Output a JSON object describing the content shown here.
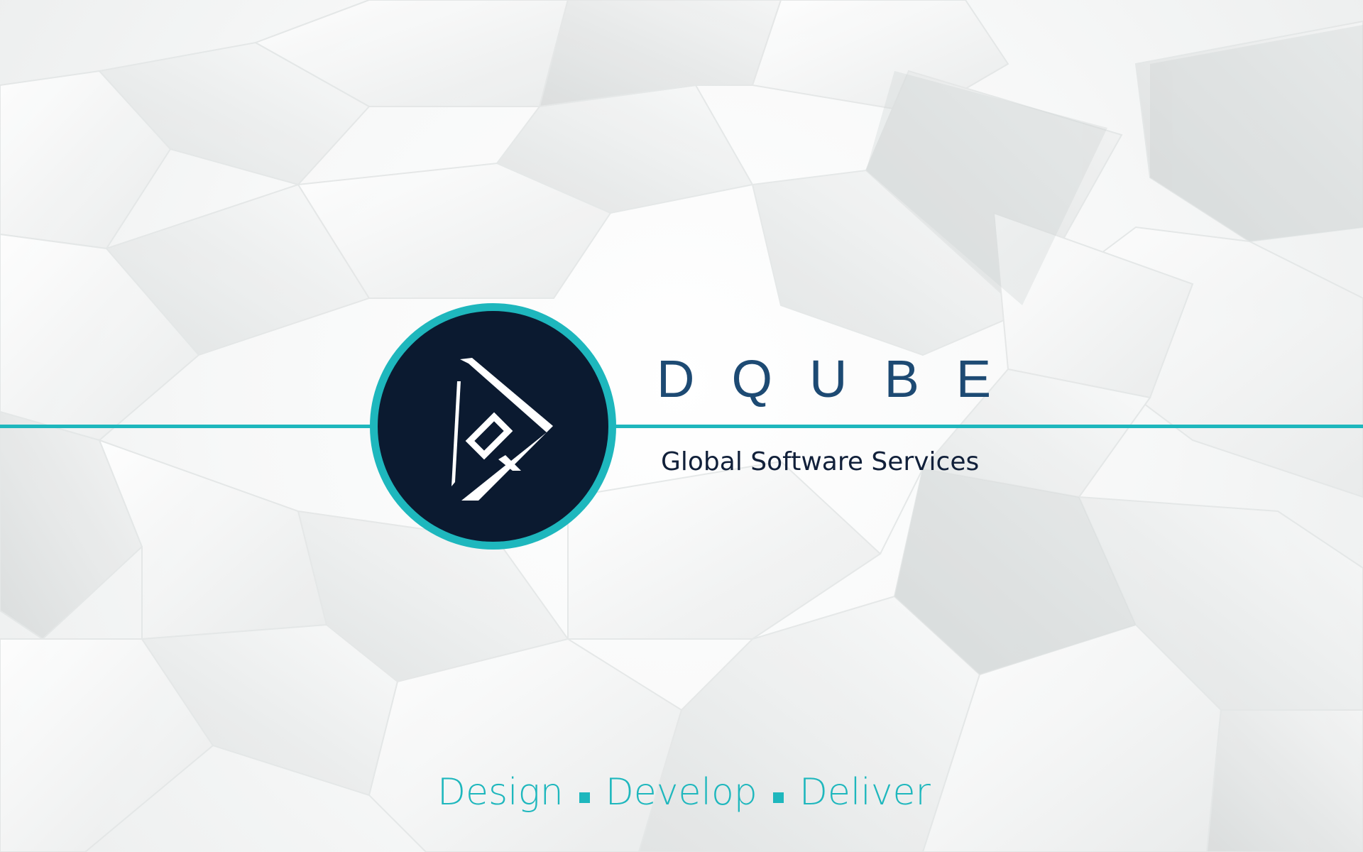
{
  "brand": {
    "name": "DQUBE",
    "subtitle": "Global Software Services"
  },
  "tagline": {
    "items": [
      "Design",
      "Develop",
      "Deliver"
    ]
  },
  "logo": {
    "icon": "dqube-logo-icon"
  },
  "colors": {
    "accent": "#1eb7bd",
    "logo_bg": "#0b1a30",
    "brand_text": "#1d4a73",
    "subtitle_text": "#11203a"
  }
}
